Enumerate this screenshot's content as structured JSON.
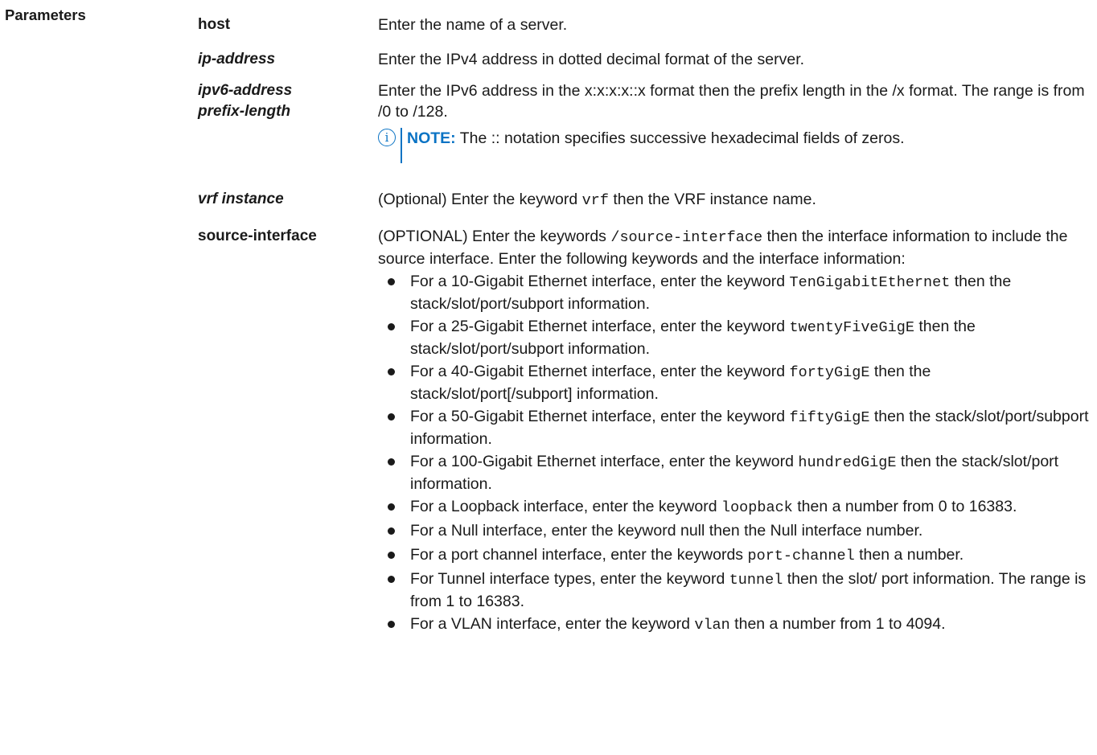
{
  "section_label": "Parameters",
  "params": [
    {
      "term": "host",
      "desc": "Enter the name of a server."
    },
    {
      "term": "ip-address",
      "desc": "Enter the IPv4 address in dotted decimal format of the server."
    },
    {
      "term_line1": "ipv6-address",
      "term_line2": "prefix-length",
      "desc": "Enter the IPv6 address in the x:x:x:x::x format then the prefix length in the /x format. The range is from /0 to /128.",
      "note_label": "NOTE:",
      "note_text": " The :: notation specifies successive hexadecimal fields of zeros."
    },
    {
      "term": "vrf instance",
      "desc_pre": "(Optional) Enter the keyword ",
      "desc_code": "vrf",
      "desc_post": " then the VRF instance name."
    },
    {
      "term": "source-interface",
      "desc_pre": "(OPTIONAL) Enter the keywords ",
      "desc_code": "/source-interface",
      "desc_post": " then the interface information to include the source interface. Enter the following keywords and the interface information:",
      "bullets": [
        {
          "pre": "For a 10-Gigabit Ethernet interface, enter the keyword ",
          "code": "TenGigabitEthernet",
          "post": " then the stack/slot/port/subport information."
        },
        {
          "pre": "For a 25-Gigabit Ethernet interface, enter the keyword ",
          "code": "twentyFiveGigE",
          "post": " then the stack/slot/port/subport information."
        },
        {
          "pre": "For a 40-Gigabit Ethernet interface, enter the keyword ",
          "code": "fortyGigE",
          "post": " then the stack/slot/port[/subport] information."
        },
        {
          "pre": "For a 50-Gigabit Ethernet interface, enter the keyword ",
          "code": "fiftyGigE",
          "post": " then the stack/slot/port/subport information."
        },
        {
          "pre": "For a 100-Gigabit Ethernet interface, enter the keyword ",
          "code": "hundredGigE",
          "post": " then the stack/slot/port information."
        },
        {
          "pre": "For a Loopback interface, enter the keyword ",
          "code": "loopback",
          "post": " then a number from 0 to 16383."
        },
        {
          "pre": "For a Null interface, enter the keyword null then the Null interface number.",
          "code": "",
          "post": ""
        },
        {
          "pre": "For a port channel interface, enter the keywords ",
          "code": "port-channel",
          "post": " then a number."
        },
        {
          "pre": "For Tunnel interface types, enter the keyword ",
          "code": "tunnel",
          "post": " then the slot/ port information. The range is from 1 to 16383."
        },
        {
          "pre": "For a VLAN interface, enter the keyword ",
          "code": "vlan",
          "post": " then a number from 1 to 4094."
        }
      ]
    }
  ],
  "icons": {
    "note": "info-icon"
  },
  "colors": {
    "accent": "#0a73c4",
    "text": "#1a1a1a"
  }
}
